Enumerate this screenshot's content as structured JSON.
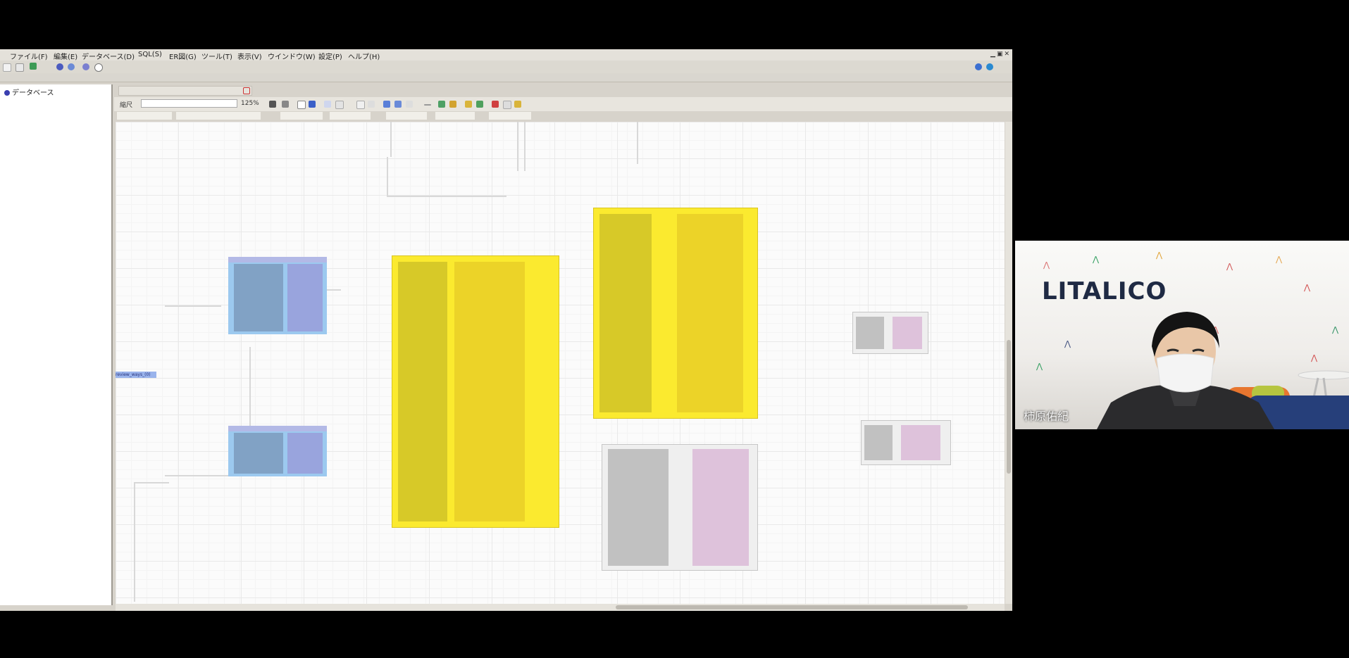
{
  "menubar": {
    "items": [
      "ファイル(F)",
      "編集(E)",
      "データベース(D)",
      "SQL(S)",
      "ER図(G)",
      "ツール(T)",
      "表示(V)",
      "ウインドウ(W)",
      "設定(P)",
      "ヘルプ(H)"
    ]
  },
  "tree": {
    "root_label": "データベース"
  },
  "editor": {
    "zoom_label": "縮尺",
    "zoom_value": "125%",
    "selected_entity_label": "review_ways_(0)"
  },
  "webcam": {
    "brand": "LITALICO",
    "participant_name": "柿原佑紀"
  },
  "colors": {
    "entity_yellow": "#fbea2f",
    "entity_blue": "#9cc9ef",
    "entity_gray": "#efefef",
    "background": "#000000"
  }
}
